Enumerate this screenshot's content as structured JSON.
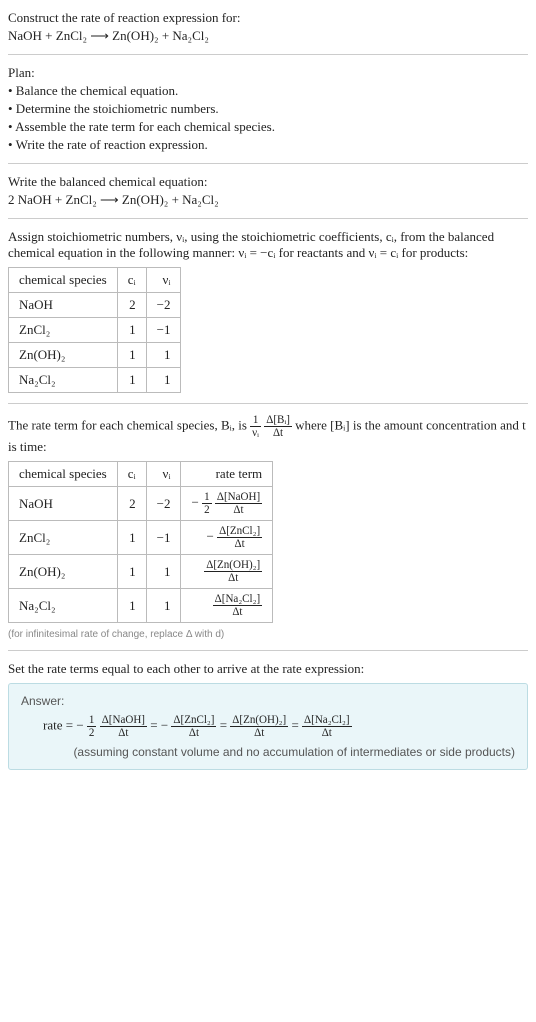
{
  "intro": {
    "title": "Construct the rate of reaction expression for:",
    "equation": "NaOH + ZnCl₂ ⟶ Zn(OH)₂ + Na₂Cl₂"
  },
  "plan": {
    "heading": "Plan:",
    "items": [
      "• Balance the chemical equation.",
      "• Determine the stoichiometric numbers.",
      "• Assemble the rate term for each chemical species.",
      "• Write the rate of reaction expression."
    ]
  },
  "balanced": {
    "heading": "Write the balanced chemical equation:",
    "equation": "2 NaOH + ZnCl₂ ⟶ Zn(OH)₂ + Na₂Cl₂"
  },
  "assign": {
    "text1": "Assign stoichiometric numbers, νᵢ, using the stoichiometric coefficients, cᵢ, from the balanced chemical equation in the following manner: νᵢ = −cᵢ for reactants and νᵢ = cᵢ for products:",
    "headers": [
      "chemical species",
      "cᵢ",
      "νᵢ"
    ],
    "rows": [
      [
        "NaOH",
        "2",
        "−2"
      ],
      [
        "ZnCl₂",
        "1",
        "−1"
      ],
      [
        "Zn(OH)₂",
        "1",
        "1"
      ],
      [
        "Na₂Cl₂",
        "1",
        "1"
      ]
    ]
  },
  "rateterm": {
    "text_pre": "The rate term for each chemical species, Bᵢ, is ",
    "frac1_num": "1",
    "frac1_den": "νᵢ",
    "frac2_num": "Δ[Bᵢ]",
    "frac2_den": "Δt",
    "text_post": " where [Bᵢ] is the amount concentration and t is time:",
    "headers": [
      "chemical species",
      "cᵢ",
      "νᵢ",
      "rate term"
    ],
    "rows": [
      {
        "sp": "NaOH",
        "c": "2",
        "v": "−2",
        "rt": {
          "pre": "− ",
          "f1n": "1",
          "f1d": "2",
          "f2n": "Δ[NaOH]",
          "f2d": "Δt"
        }
      },
      {
        "sp": "ZnCl₂",
        "c": "1",
        "v": "−1",
        "rt": {
          "pre": "− ",
          "f2n": "Δ[ZnCl₂]",
          "f2d": "Δt"
        }
      },
      {
        "sp": "Zn(OH)₂",
        "c": "1",
        "v": "1",
        "rt": {
          "f2n": "Δ[Zn(OH)₂]",
          "f2d": "Δt"
        }
      },
      {
        "sp": "Na₂Cl₂",
        "c": "1",
        "v": "1",
        "rt": {
          "f2n": "Δ[Na₂Cl₂]",
          "f2d": "Δt"
        }
      }
    ],
    "note": "(for infinitesimal rate of change, replace Δ with d)"
  },
  "final": {
    "heading": "Set the rate terms equal to each other to arrive at the rate expression:",
    "answer_label": "Answer:",
    "expr": "rate = − ½ Δ[NaOH]/Δt = − Δ[ZnCl₂]/Δt = Δ[Zn(OH)₂]/Δt = Δ[Na₂Cl₂]/Δt",
    "assume": "(assuming constant volume and no accumulation of intermediates or side products)"
  },
  "chart_data": {
    "type": "table",
    "tables": [
      {
        "title": "Stoichiometric numbers",
        "headers": [
          "chemical species",
          "c_i",
          "nu_i"
        ],
        "rows": [
          [
            "NaOH",
            2,
            -2
          ],
          [
            "ZnCl2",
            1,
            -1
          ],
          [
            "Zn(OH)2",
            1,
            1
          ],
          [
            "Na2Cl2",
            1,
            1
          ]
        ]
      },
      {
        "title": "Rate terms",
        "headers": [
          "chemical species",
          "c_i",
          "nu_i",
          "rate term"
        ],
        "rows": [
          [
            "NaOH",
            2,
            -2,
            "-(1/2) d[NaOH]/dt"
          ],
          [
            "ZnCl2",
            1,
            -1,
            "- d[ZnCl2]/dt"
          ],
          [
            "Zn(OH)2",
            1,
            1,
            "d[Zn(OH)2]/dt"
          ],
          [
            "Na2Cl2",
            1,
            1,
            "d[Na2Cl2]/dt"
          ]
        ]
      }
    ]
  }
}
